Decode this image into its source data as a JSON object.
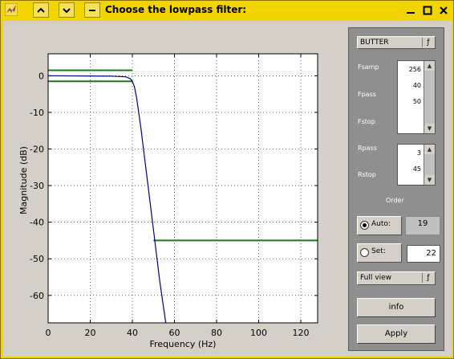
{
  "window": {
    "title": "Choose the lowpass filter:",
    "buttons": {
      "minimize": "▁",
      "maximize": "□",
      "close": "✕"
    },
    "nav_up_icon": "chevron-up-icon",
    "nav_down_icon": "chevron-down-icon",
    "menu_icon": "dash-icon"
  },
  "panel": {
    "filter_type": "BUTTER",
    "fsamp_label": "Fsamp",
    "fpass_label": "Fpass",
    "fstop_label": "Fstop",
    "freq_values": [
      "256",
      "40",
      "50"
    ],
    "rpass_label": "Rpass",
    "rstop_label": "Rstop",
    "ripple_values": [
      "3",
      "45"
    ],
    "order_label": "Order",
    "auto_label": "Auto:",
    "auto_value": "19",
    "set_label": "Set:",
    "set_value": "22",
    "view_mode": "Full view",
    "info_label": "info",
    "apply_label": "Apply"
  },
  "chart_data": {
    "type": "line",
    "xlabel": "Frequency (Hz)",
    "ylabel": "Magnitude (dB)",
    "xlim": [
      0,
      128
    ],
    "ylim": [
      -67.5,
      6
    ],
    "xticks": [
      0,
      20,
      40,
      60,
      80,
      100,
      120
    ],
    "yticks": [
      0,
      -10,
      -20,
      -30,
      -40,
      -50,
      -60
    ],
    "grid": true,
    "series": [
      {
        "color": "#000080",
        "x": [
          0,
          30,
          37,
          39,
          40,
          41,
          42,
          44,
          47,
          50,
          53,
          56
        ],
        "y": [
          0,
          -0.1,
          -0.3,
          -0.8,
          -1.5,
          -3,
          -6,
          -14,
          -28,
          -42,
          -56,
          -68
        ]
      }
    ],
    "spec_lines": [
      {
        "color": "#1a7a1a",
        "x": [
          0,
          40
        ],
        "y": [
          1.5,
          1.5
        ]
      },
      {
        "color": "#1a7a1a",
        "x": [
          0,
          40
        ],
        "y": [
          -1.5,
          -1.5
        ]
      },
      {
        "color": "#1a7a1a",
        "x": [
          50,
          128
        ],
        "y": [
          -45,
          -45
        ]
      }
    ]
  }
}
